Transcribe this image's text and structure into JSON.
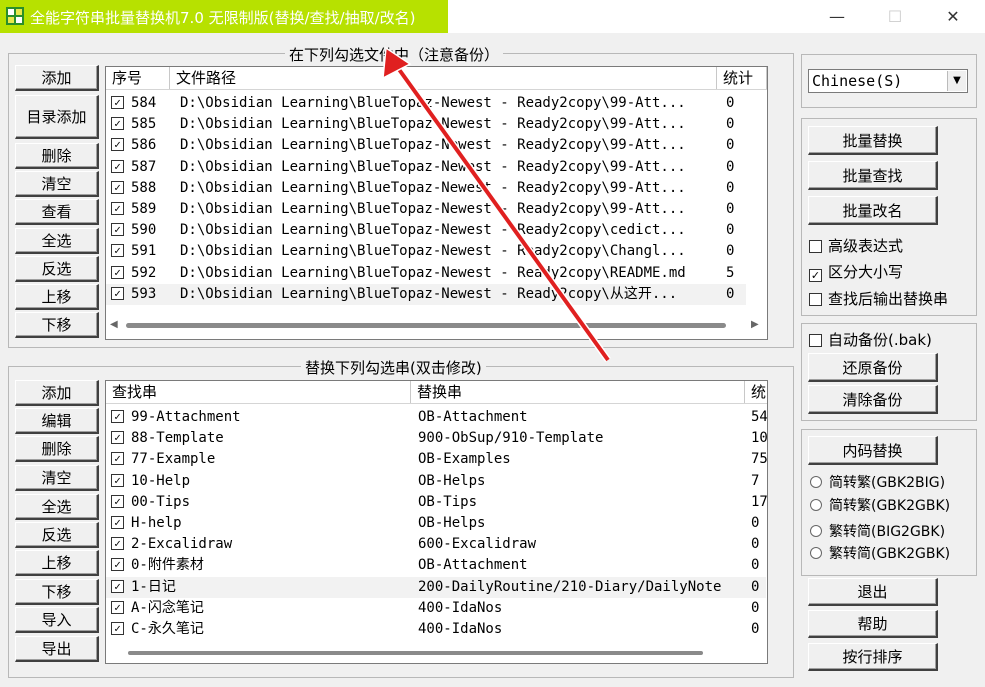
{
  "window": {
    "title": "全能字符串批量替换机7.0 无限制版(替换/查找/抽取/改名)",
    "minimize_glyph": "—",
    "maximize_glyph": "☐",
    "close_glyph": "✕",
    "title_highlight_color": "#b7e100"
  },
  "files_panel": {
    "title": "在下列勾选文件中（注意备份）",
    "buttons": [
      "添加",
      "目录添加",
      "删除",
      "清空",
      "查看",
      "全选",
      "反选",
      "上移",
      "下移"
    ],
    "columns": [
      "序号",
      "文件路径",
      "统计"
    ],
    "rows": [
      {
        "num": "584",
        "path": "D:\\Obsidian Learning\\BlueTopaz-Newest - Ready2copy\\99-Att...",
        "count": "0",
        "checked": true
      },
      {
        "num": "585",
        "path": "D:\\Obsidian Learning\\BlueTopaz-Newest - Ready2copy\\99-Att...",
        "count": "0",
        "checked": true
      },
      {
        "num": "586",
        "path": "D:\\Obsidian Learning\\BlueTopaz-Newest - Ready2copy\\99-Att...",
        "count": "0",
        "checked": true
      },
      {
        "num": "587",
        "path": "D:\\Obsidian Learning\\BlueTopaz-Newest - Ready2copy\\99-Att...",
        "count": "0",
        "checked": true
      },
      {
        "num": "588",
        "path": "D:\\Obsidian Learning\\BlueTopaz-Newest - Ready2copy\\99-Att...",
        "count": "0",
        "checked": true
      },
      {
        "num": "589",
        "path": "D:\\Obsidian Learning\\BlueTopaz-Newest - Ready2copy\\99-Att...",
        "count": "0",
        "checked": true
      },
      {
        "num": "590",
        "path": "D:\\Obsidian Learning\\BlueTopaz-Newest - Ready2copy\\cedict...",
        "count": "0",
        "checked": true
      },
      {
        "num": "591",
        "path": "D:\\Obsidian Learning\\BlueTopaz-Newest - Ready2copy\\Changl...",
        "count": "0",
        "checked": true
      },
      {
        "num": "592",
        "path": "D:\\Obsidian Learning\\BlueTopaz-Newest - Ready2copy\\README.md",
        "count": "5",
        "checked": true
      },
      {
        "num": "593",
        "path": "D:\\Obsidian Learning\\BlueTopaz-Newest - Ready2copy\\从这开...",
        "count": "0",
        "checked": true
      }
    ]
  },
  "replace_panel": {
    "title": "替换下列勾选串(双击修改)",
    "buttons": [
      "添加",
      "编辑",
      "删除",
      "清空",
      "全选",
      "反选",
      "上移",
      "下移",
      "导入",
      "导出"
    ],
    "columns": [
      "查找串",
      "替换串",
      "统"
    ],
    "rows": [
      {
        "find": "99-Attachment",
        "replace": "OB-Attachment",
        "count": "54",
        "checked": true
      },
      {
        "find": "88-Template",
        "replace": "900-ObSup/910-Template",
        "count": "10",
        "checked": true
      },
      {
        "find": "77-Example",
        "replace": "OB-Examples",
        "count": "75",
        "checked": true
      },
      {
        "find": "10-Help",
        "replace": "OB-Helps",
        "count": "7",
        "checked": true
      },
      {
        "find": "00-Tips",
        "replace": "OB-Tips",
        "count": "17",
        "checked": true
      },
      {
        "find": "H-help",
        "replace": "OB-Helps",
        "count": "0",
        "checked": true
      },
      {
        "find": "2-Excalidraw",
        "replace": "600-Excalidraw",
        "count": "0",
        "checked": true
      },
      {
        "find": "0-附件素材",
        "replace": "OB-Attachment",
        "count": "0",
        "checked": true
      },
      {
        "find": "1-日记",
        "replace": "200-DailyRoutine/210-Diary/DailyNote",
        "count": "0",
        "checked": true
      },
      {
        "find": "A-闪念笔记",
        "replace": "400-IdaNos",
        "count": "0",
        "checked": true
      },
      {
        "find": "C-永久笔记",
        "replace": "400-IdaNos",
        "count": "0",
        "checked": true
      }
    ]
  },
  "language": {
    "selected": "Chinese(S)"
  },
  "actions": {
    "buttons": [
      "批量替换",
      "批量查找",
      "批量改名"
    ],
    "options": [
      {
        "label": "高级表达式",
        "checked": false
      },
      {
        "label": "区分大小写",
        "checked": true
      },
      {
        "label": "查找后输出替换串",
        "checked": false
      }
    ]
  },
  "backup": {
    "auto_label": "自动备份(.bak)",
    "auto_checked": false,
    "restore_label": "还原备份",
    "clear_label": "清除备份"
  },
  "encoding": {
    "button": "内码替换",
    "radios": [
      "简转繁(GBK2BIG)",
      "简转繁(GBK2GBK)",
      "繁转简(BIG2GBK)",
      "繁转简(GBK2GBK)"
    ]
  },
  "bottom": {
    "buttons": [
      "退出",
      "帮助",
      "按行排序"
    ]
  },
  "check_glyph": "✓"
}
